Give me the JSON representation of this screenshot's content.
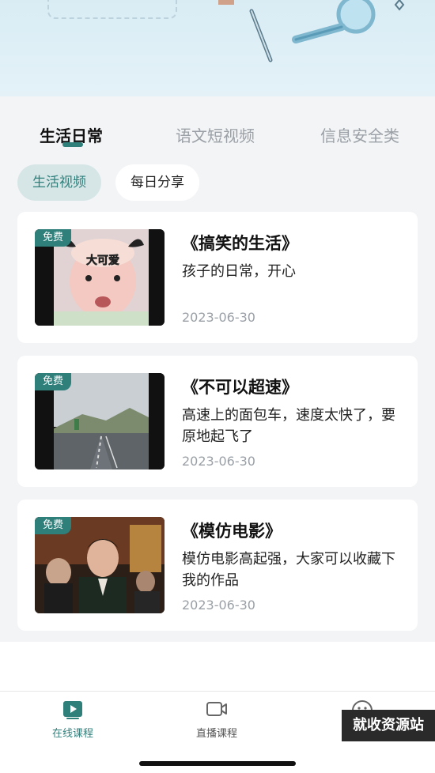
{
  "tabs": [
    {
      "label": "生活日常",
      "active": true
    },
    {
      "label": "语文短视频",
      "active": false
    },
    {
      "label": "信息安全类",
      "active": false
    }
  ],
  "chips": [
    {
      "label": "生活视频",
      "active": true
    },
    {
      "label": "每日分享",
      "active": false
    }
  ],
  "videos": [
    {
      "badge": "免费",
      "title": "《搞笑的生活》",
      "desc": "孩子的日常，开心",
      "date": "2023-06-30",
      "thumb_overlay": "大可爱"
    },
    {
      "badge": "免费",
      "title": "《不可以超速》",
      "desc": "高速上的面包车，速度太快了，要原地起飞了",
      "date": "2023-06-30"
    },
    {
      "badge": "免费",
      "title": "《模仿电影》",
      "desc": "模仿电影高起强，大家可以收藏下我的作品",
      "date": "2023-06-30"
    }
  ],
  "nav": [
    {
      "label": "在线课程",
      "icon": "play-video-icon",
      "active": true
    },
    {
      "label": "直播课程",
      "icon": "camera-icon",
      "active": false
    },
    {
      "label": "",
      "icon": "smiley-icon",
      "active": false
    }
  ],
  "watermark": "就收资源站",
  "colors": {
    "accent": "#2f7f7b",
    "chip_active_bg": "#d6e6e7",
    "background": "#f3f4f6"
  }
}
